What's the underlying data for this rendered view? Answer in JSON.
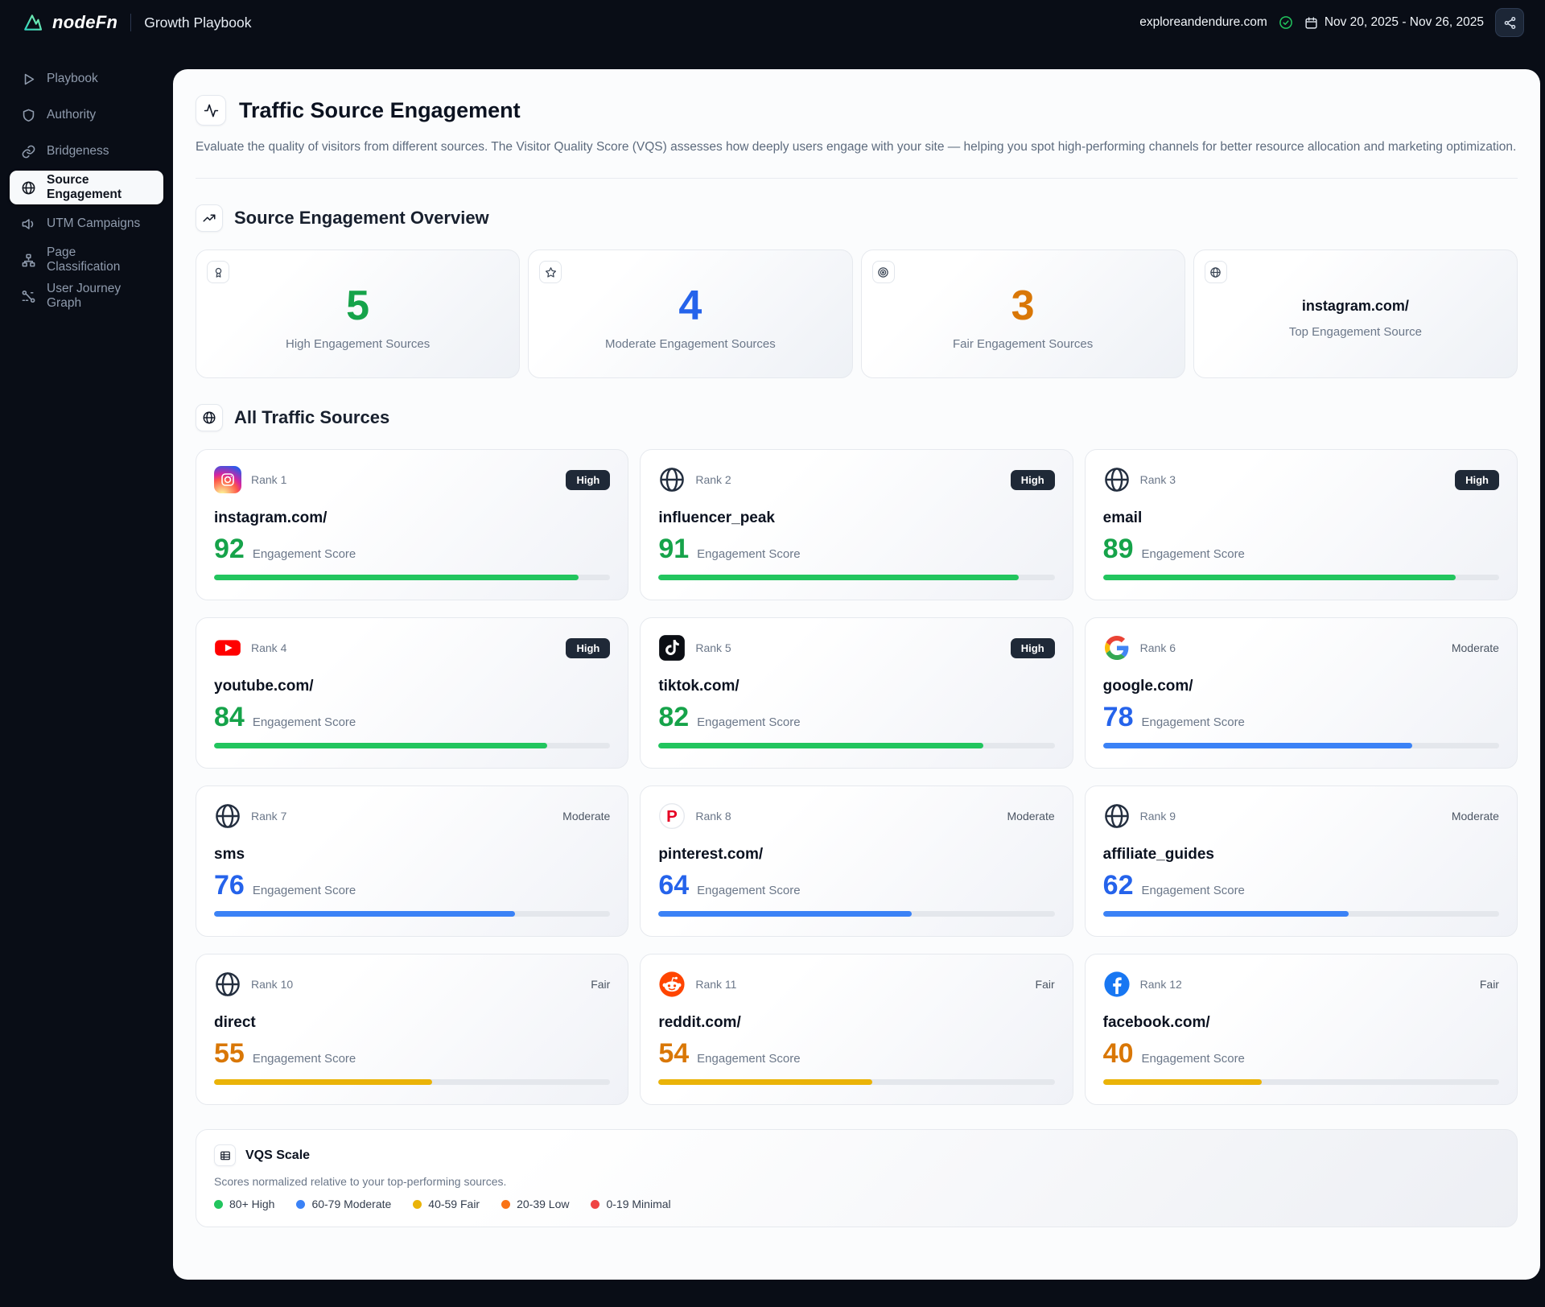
{
  "topbar": {
    "brand": "nodeFn",
    "app_title": "Growth Playbook",
    "domain": "exploreandendure.com",
    "date_range": "Nov 20, 2025 - Nov 26, 2025"
  },
  "sidebar": {
    "items": [
      {
        "label": "Playbook",
        "icon": "play-icon",
        "active": false
      },
      {
        "label": "Authority",
        "icon": "shield-icon",
        "active": false
      },
      {
        "label": "Bridgeness",
        "icon": "link-icon",
        "active": false
      },
      {
        "label": "Source Engagement",
        "icon": "globe-icon",
        "active": true
      },
      {
        "label": "UTM Campaigns",
        "icon": "megaphone-icon",
        "active": false
      },
      {
        "label": "Page Classification",
        "icon": "sitemap-icon",
        "active": false
      },
      {
        "label": "User Journey Graph",
        "icon": "journey-icon",
        "active": false
      }
    ]
  },
  "header": {
    "title": "Traffic Source Engagement",
    "description": "Evaluate the quality of visitors from different sources. The Visitor Quality Score (VQS) assesses how deeply users engage with your site — helping you spot high-performing channels for better resource allocation and marketing optimization."
  },
  "overview": {
    "title": "Source Engagement Overview",
    "stats": [
      {
        "value": "5",
        "label": "High Engagement Sources",
        "icon": "award-icon",
        "color": "#16a34a"
      },
      {
        "value": "4",
        "label": "Moderate Engagement Sources",
        "icon": "star-icon",
        "color": "#2563eb"
      },
      {
        "value": "3",
        "label": "Fair Engagement Sources",
        "icon": "target-icon",
        "color": "#d97706"
      },
      {
        "value": "instagram.com/",
        "label": "Top Engagement Source",
        "icon": "globe-icon",
        "is_text": true
      }
    ]
  },
  "sources": {
    "title": "All Traffic Sources",
    "score_label": "Engagement Score",
    "cards": [
      {
        "rank": "Rank 1",
        "name": "instagram.com/",
        "score": 92,
        "tier": "High",
        "platform": "instagram"
      },
      {
        "rank": "Rank 2",
        "name": "influencer_peak",
        "score": 91,
        "tier": "High",
        "platform": "globe"
      },
      {
        "rank": "Rank 3",
        "name": "email",
        "score": 89,
        "tier": "High",
        "platform": "globe"
      },
      {
        "rank": "Rank 4",
        "name": "youtube.com/",
        "score": 84,
        "tier": "High",
        "platform": "youtube"
      },
      {
        "rank": "Rank 5",
        "name": "tiktok.com/",
        "score": 82,
        "tier": "High",
        "platform": "tiktok"
      },
      {
        "rank": "Rank 6",
        "name": "google.com/",
        "score": 78,
        "tier": "Moderate",
        "platform": "google"
      },
      {
        "rank": "Rank 7",
        "name": "sms",
        "score": 76,
        "tier": "Moderate",
        "platform": "globe"
      },
      {
        "rank": "Rank 8",
        "name": "pinterest.com/",
        "score": 64,
        "tier": "Moderate",
        "platform": "pinterest"
      },
      {
        "rank": "Rank 9",
        "name": "affiliate_guides",
        "score": 62,
        "tier": "Moderate",
        "platform": "globe"
      },
      {
        "rank": "Rank 10",
        "name": "direct",
        "score": 55,
        "tier": "Fair",
        "platform": "globe"
      },
      {
        "rank": "Rank 11",
        "name": "reddit.com/",
        "score": 54,
        "tier": "Fair",
        "platform": "reddit"
      },
      {
        "rank": "Rank 12",
        "name": "facebook.com/",
        "score": 40,
        "tier": "Fair",
        "platform": "facebook"
      }
    ]
  },
  "vqs": {
    "title": "VQS Scale",
    "subtitle": "Scores normalized relative to your top-performing sources.",
    "legend": [
      {
        "label": "80+ High",
        "color": "#22c55e"
      },
      {
        "label": "60-79 Moderate",
        "color": "#3b82f6"
      },
      {
        "label": "40-59 Fair",
        "color": "#eab308"
      },
      {
        "label": "20-39 Low",
        "color": "#f97316"
      },
      {
        "label": "0-19 Minimal",
        "color": "#ef4444"
      }
    ]
  },
  "colors": {
    "high_num": "#16a34a",
    "high_bar": "#22c55e",
    "moderate_num": "#2563eb",
    "moderate_bar": "#3b82f6",
    "fair_num": "#d97706",
    "fair_bar": "#eab308"
  }
}
